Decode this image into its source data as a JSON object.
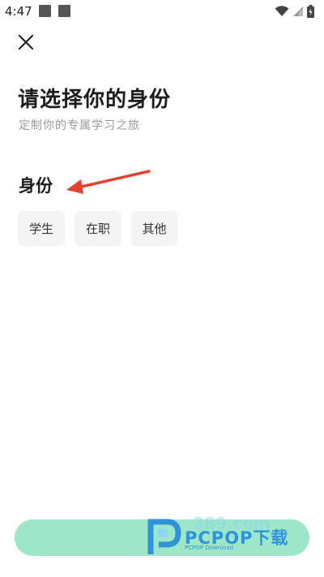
{
  "status_bar": {
    "time": "4:47"
  },
  "header": {
    "title": "请选择你的身份",
    "subtitle": "定制你的专属学习之旅"
  },
  "identity_section": {
    "label": "身份",
    "options": [
      {
        "label": "学生"
      },
      {
        "label": "在职"
      },
      {
        "label": "其他"
      }
    ]
  },
  "watermark": {
    "brand": "PCPOP下载",
    "sub": "PCPOP Download",
    "number": "289.com"
  },
  "colors": {
    "confirm_button": "#9de6c8",
    "chip_background": "#f4f4f4",
    "annotation_arrow": "#e4442f",
    "watermark_blue": "#2a8fd8"
  },
  "icons": {
    "close": "close-icon",
    "arrow": "arrow-left-icon"
  }
}
